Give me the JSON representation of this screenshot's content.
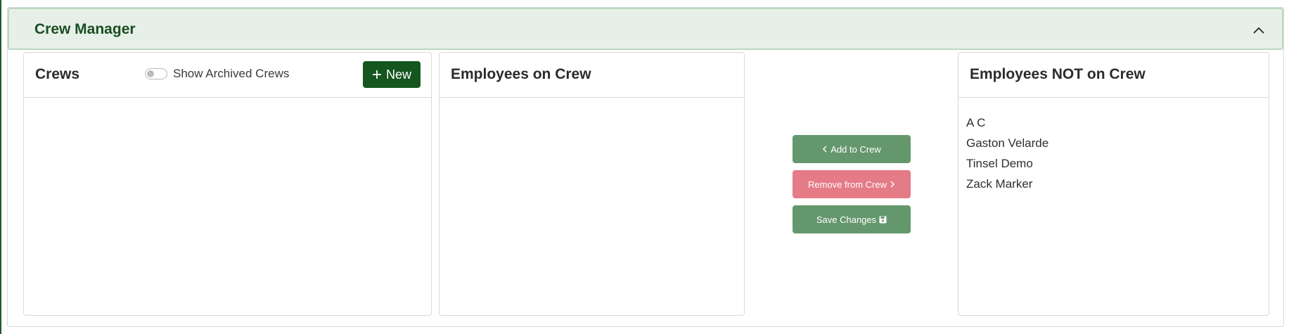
{
  "panel": {
    "title": "Crew Manager"
  },
  "crews": {
    "title": "Crews",
    "toggle_label": "Show Archived Crews",
    "toggle_on": false,
    "new_label": "New"
  },
  "employees_on_crew": {
    "title": "Employees on Crew",
    "items": []
  },
  "actions": {
    "add_label": "Add to Crew",
    "remove_label": "Remove from Crew",
    "save_label": "Save Changes"
  },
  "employees_not_on_crew": {
    "title": "Employees NOT on Crew",
    "items": [
      "A C",
      "Gaston Velarde",
      "Tinsel Demo",
      "Zack Marker"
    ]
  },
  "colors": {
    "primary": "#15561f",
    "header_bg": "#e7f0e8",
    "action_green": "#65976d",
    "action_red": "#e47b86"
  }
}
